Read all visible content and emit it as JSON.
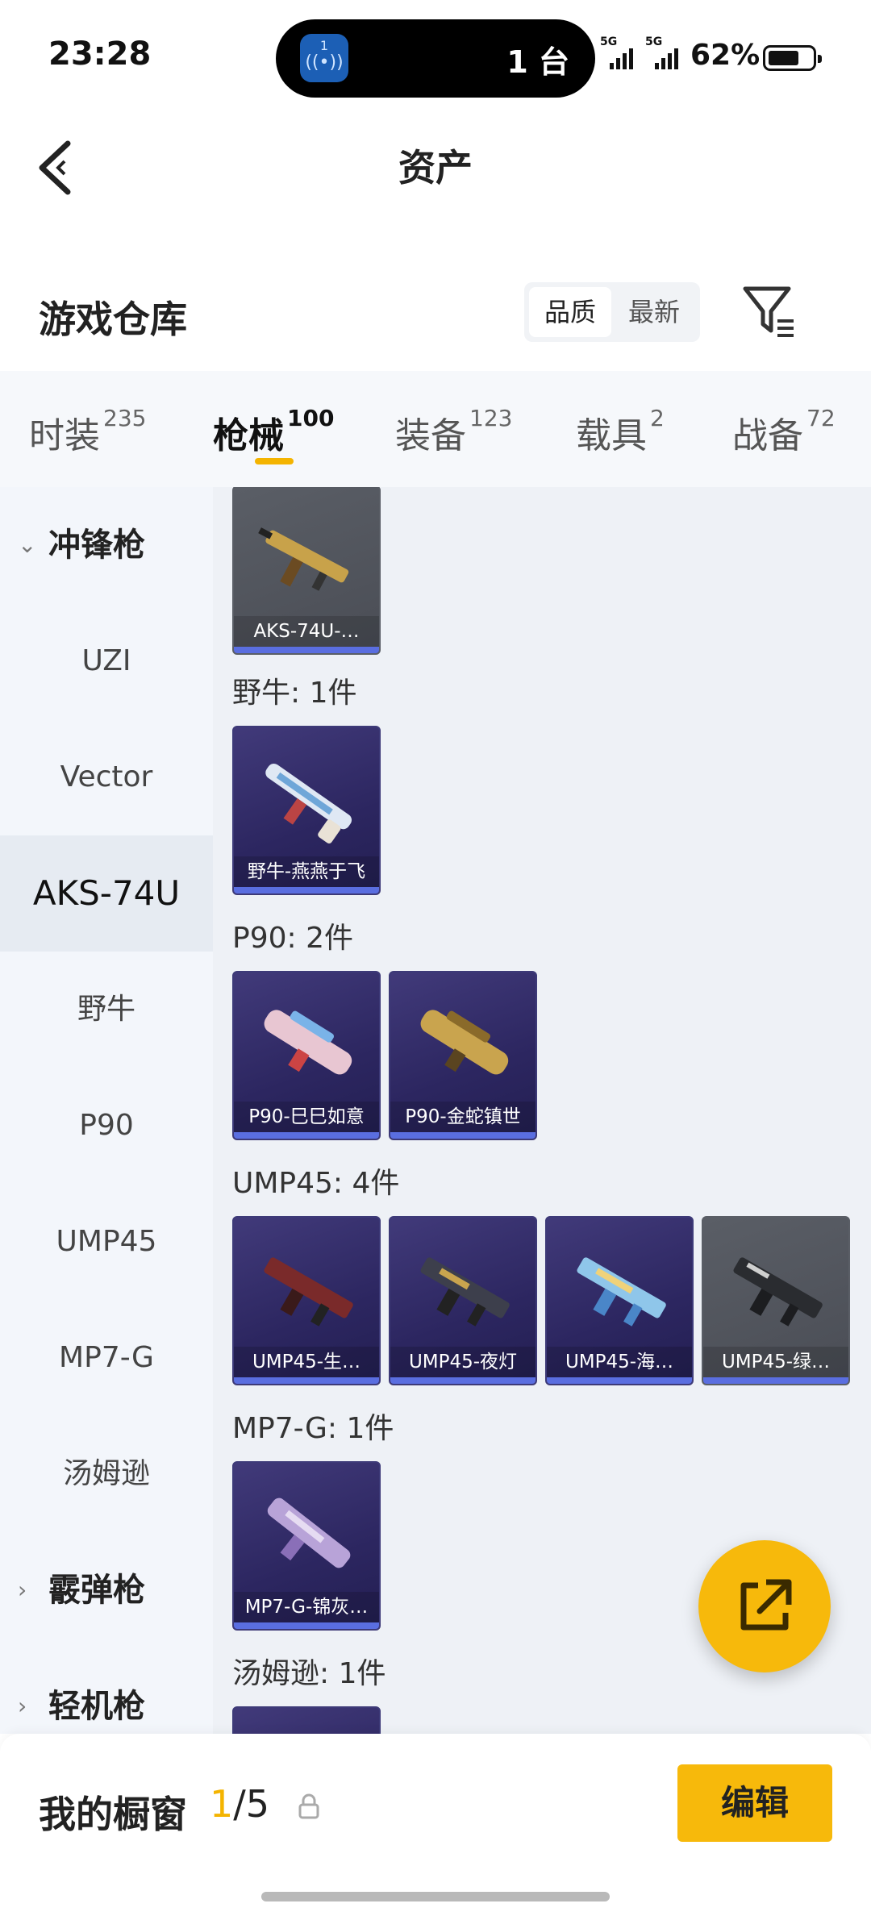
{
  "status_bar": {
    "time": "23:28",
    "island_app_number": "1",
    "island_app_wave": "((•))",
    "island_text": "1 台",
    "sim1": "5G",
    "sim2": "5G",
    "battery": "62%",
    "battery_level": 0.62
  },
  "header": {
    "title": "资产",
    "back_icon": "chevron-left-icon"
  },
  "warehouse": {
    "title": "游戏仓库",
    "sort_options": [
      "品质",
      "最新"
    ],
    "sort_selected": "品质",
    "filter_icon": "filter-icon"
  },
  "tabs": [
    {
      "label": "时装",
      "count": "235"
    },
    {
      "label": "枪械",
      "count": "100",
      "active": true
    },
    {
      "label": "装备",
      "count": "123"
    },
    {
      "label": "载具",
      "count": "2"
    },
    {
      "label": "战备",
      "count": "72"
    }
  ],
  "sidebar": {
    "category_open": "冲锋枪",
    "items": [
      "UZI",
      "Vector",
      "AKS-74U",
      "野牛",
      "P90",
      "UMP45",
      "MP7-G",
      "汤姆逊"
    ],
    "selected": "AKS-74U",
    "categories_closed": [
      "霰弹枪",
      "轻机枪"
    ]
  },
  "groups": [
    {
      "title": "",
      "items": [
        {
          "name": "AKS-74U-…",
          "style": "gray"
        }
      ]
    },
    {
      "title": "野牛: 1件",
      "items": [
        {
          "name": "野牛-燕燕于飞",
          "style": "purple"
        }
      ]
    },
    {
      "title": "P90: 2件",
      "items": [
        {
          "name": "P90-巳巳如意",
          "style": "purple"
        },
        {
          "name": "P90-金蛇镇世",
          "style": "purple"
        }
      ]
    },
    {
      "title": "UMP45: 4件",
      "items": [
        {
          "name": "UMP45-生…",
          "style": "purple"
        },
        {
          "name": "UMP45-夜灯",
          "style": "purple"
        },
        {
          "name": "UMP45-海…",
          "style": "purple"
        },
        {
          "name": "UMP45-绿…",
          "style": "gray"
        }
      ]
    },
    {
      "title": "MP7-G: 1件",
      "items": [
        {
          "name": "MP7-G-锦灰…",
          "style": "purple"
        }
      ]
    },
    {
      "title": "汤姆逊: 1件",
      "items": []
    }
  ],
  "fab_icon": "share-external-icon",
  "showcase": {
    "label": "我的橱窗",
    "current": "1",
    "total": "/5",
    "lock_icon": "lock-icon",
    "edit_label": "编辑"
  },
  "colors": {
    "accent": "#f7b90b",
    "tab_indicator": "#f4b400",
    "card_purple": "#2c2660",
    "rarity_bar": "#5a6ee0"
  }
}
